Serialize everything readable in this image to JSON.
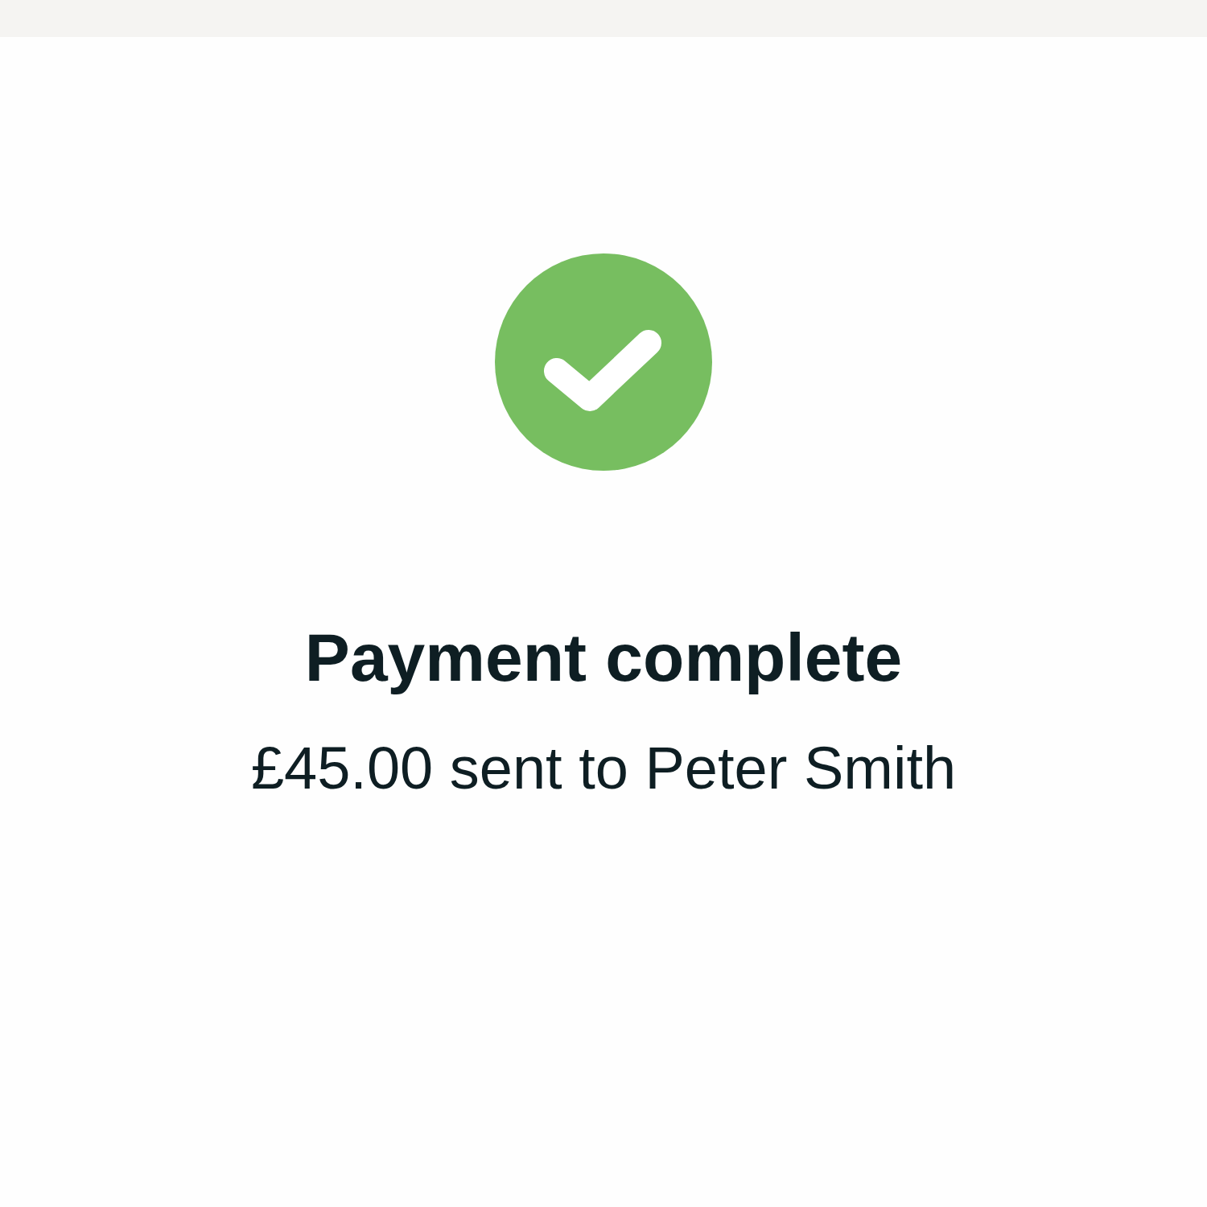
{
  "title": "Payment complete",
  "message": "£45.00 sent to Peter Smith"
}
